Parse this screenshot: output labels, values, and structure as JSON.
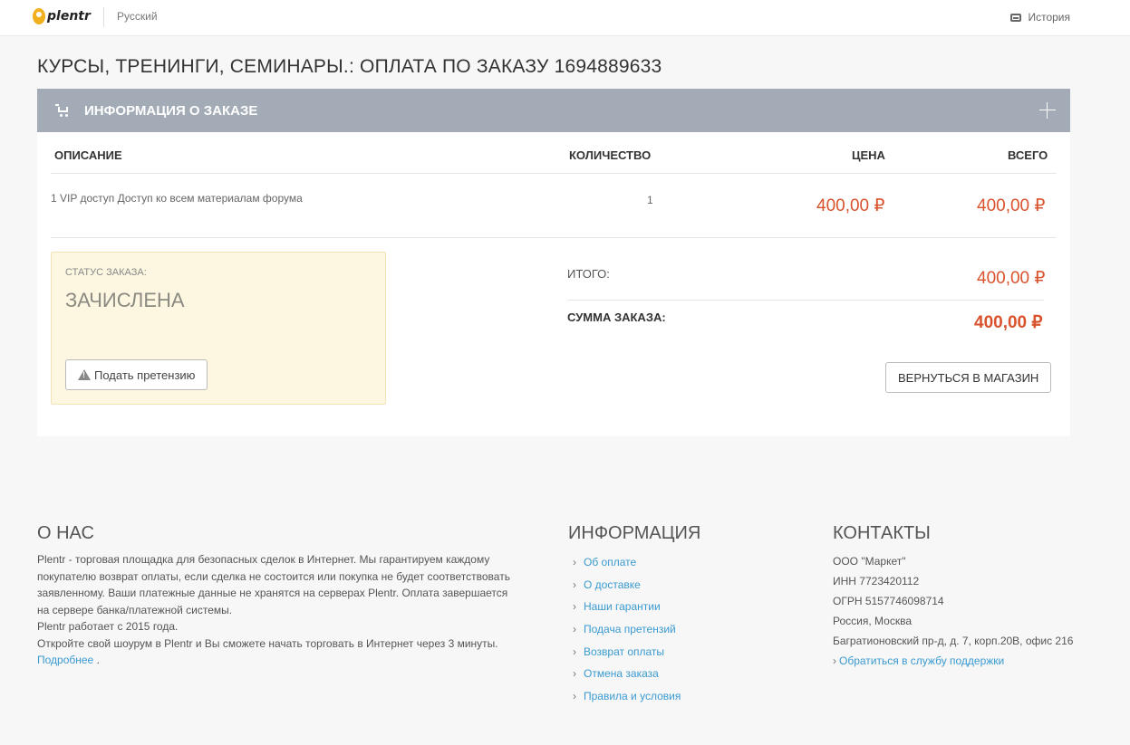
{
  "header": {
    "logo_text": "plentr",
    "language": "Русский",
    "history": "История"
  },
  "page_title": "КУРСЫ, ТРЕНИНГИ, СЕМИНАРЫ.: ОПЛАТА ПО ЗАКАЗУ 1694889633",
  "order": {
    "section_title": "ИНФОРМАЦИЯ О ЗАКАЗЕ",
    "columns": {
      "description": "ОПИСАНИЕ",
      "quantity": "КОЛИЧЕСТВО",
      "price": "ЦЕНА",
      "total": "ВСЕГО"
    },
    "items": [
      {
        "description": "1 VIP доступ Доступ ко всем материалам форума",
        "quantity": "1",
        "price": "400,00 ₽",
        "total": "400,00 ₽"
      }
    ],
    "status_label": "СТАТУС ЗАКАЗА:",
    "status_value": "ЗАЧИСЛЕНА",
    "claim_button": "Подать претензию",
    "subtotal_label": "ИТОГО:",
    "subtotal_value": "400,00 ₽",
    "sum_label": "СУММА ЗАКАЗА:",
    "sum_value": "400,00 ₽",
    "back_button": "ВЕРНУТЬСЯ В МАГАЗИН"
  },
  "footer": {
    "about_title": "О НАС",
    "about_text": "Plentr - торговая площадка для безопасных сделок в Интернет. Мы гарантируем каждому покупателю возврат оплаты, если сделка не состоится или покупка не будет соответствовать заявленному. Ваши платежные данные не хранятся на серверах Plentr. Оплата завершается на сервере банка/платежной системы.",
    "about_since": "Plentr работает с 2015 года.",
    "about_cta": "Откройте свой шоурум в Plentr и Вы сможете начать торговать в Интернет через 3 минуты.",
    "about_more": "Подробнее",
    "about_more_suffix": " .",
    "info_title": "ИНФОРМАЦИЯ",
    "info_links": [
      "Об оплате",
      "О доставке",
      "Наши гарантии",
      "Подача претензий",
      "Возврат оплаты",
      "Отмена заказа",
      "Правила и условия"
    ],
    "contacts_title": "КОНТАКТЫ",
    "company": "ООО \"Маркет\"",
    "inn": "ИНН 7723420112",
    "ogrn": "ОГРН 5157746098714",
    "city": "Россия, Москва",
    "address": "Багратионовский пр-д, д. 7, корп.20В, офис 216",
    "support_link": "Обратиться в службу поддержки"
  },
  "colors": {
    "header_bar": "#a3abb6",
    "price": "#d9532d",
    "link": "#3a9ad0",
    "status_bg": "#fdf7e2"
  }
}
